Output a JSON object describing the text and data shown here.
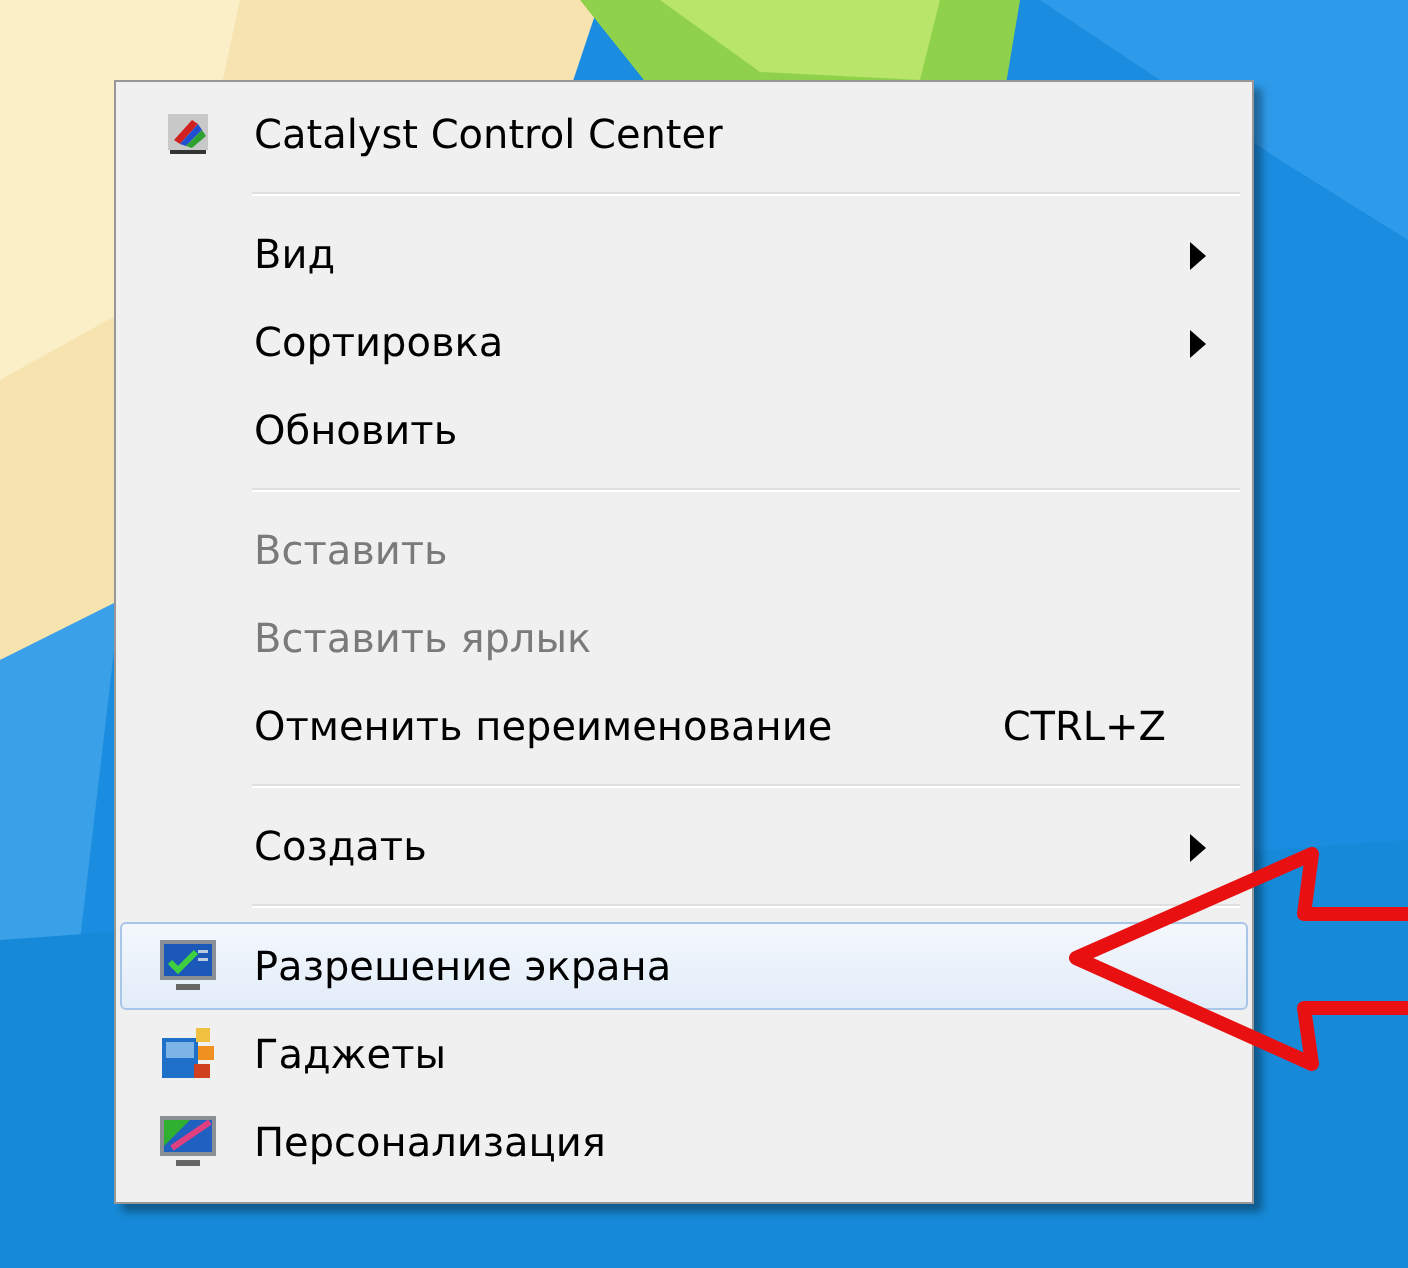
{
  "context_menu": {
    "items": [
      {
        "kind": "item",
        "label": "Catalyst Control Center",
        "disabled": false,
        "selected": false,
        "submenu": false
      },
      {
        "kind": "separator"
      },
      {
        "kind": "item",
        "label": "Вид",
        "disabled": false,
        "selected": false,
        "submenu": true
      },
      {
        "kind": "item",
        "label": "Сортировка",
        "disabled": false,
        "selected": false,
        "submenu": true
      },
      {
        "kind": "item",
        "label": "Обновить",
        "disabled": false,
        "selected": false,
        "submenu": false
      },
      {
        "kind": "separator"
      },
      {
        "kind": "item",
        "label": "Вставить",
        "disabled": true,
        "selected": false,
        "submenu": false
      },
      {
        "kind": "item",
        "label": "Вставить ярлык",
        "disabled": true,
        "selected": false,
        "submenu": false
      },
      {
        "kind": "item",
        "label": "Отменить переименование",
        "shortcut": "CTRL+Z",
        "disabled": false,
        "selected": false,
        "submenu": false
      },
      {
        "kind": "separator"
      },
      {
        "kind": "item",
        "label": "Создать",
        "disabled": false,
        "selected": false,
        "submenu": true
      },
      {
        "kind": "separator"
      },
      {
        "kind": "item",
        "label": "Разрешение экрана",
        "disabled": false,
        "selected": true,
        "submenu": false
      },
      {
        "kind": "item",
        "label": "Гаджеты",
        "disabled": false,
        "selected": false,
        "submenu": false
      },
      {
        "kind": "item",
        "label": "Персонализация",
        "disabled": false,
        "selected": false,
        "submenu": false
      }
    ]
  }
}
